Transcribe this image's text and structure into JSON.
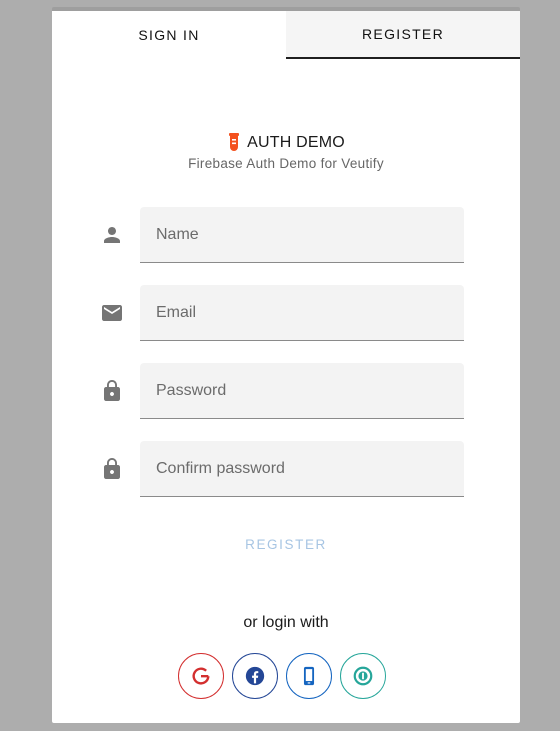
{
  "tabs": [
    {
      "label": "SIGN IN",
      "active": true
    },
    {
      "label": "REGISTER",
      "active": false
    }
  ],
  "brand": {
    "title": "AUTH DEMO",
    "subtitle": "Firebase Auth Demo for Veutify",
    "icon": "test-tube-icon",
    "icon_color": "#f4511e"
  },
  "fields": {
    "name": {
      "placeholder": "Name",
      "icon": "person-icon"
    },
    "email": {
      "placeholder": "Email",
      "icon": "email-icon"
    },
    "password": {
      "placeholder": "Password",
      "icon": "lock-icon"
    },
    "confirm": {
      "placeholder": "Confirm password",
      "icon": "lock-icon"
    }
  },
  "register_button": {
    "label": "REGISTER",
    "color": "#a7c5e3"
  },
  "or_login_with": "or login with",
  "social": [
    {
      "name": "google",
      "icon": "google-icon",
      "color": "#d32f2f"
    },
    {
      "name": "facebook",
      "icon": "facebook-icon",
      "color": "#244796"
    },
    {
      "name": "phone",
      "icon": "phone-icon",
      "color": "#1565c0"
    },
    {
      "name": "anonymous",
      "icon": "anonymous-icon",
      "color": "#26a69a"
    }
  ],
  "colors": {
    "background": "#adadad",
    "card": "#ffffff",
    "field": "#f3f3f3",
    "icon": "#757575"
  }
}
